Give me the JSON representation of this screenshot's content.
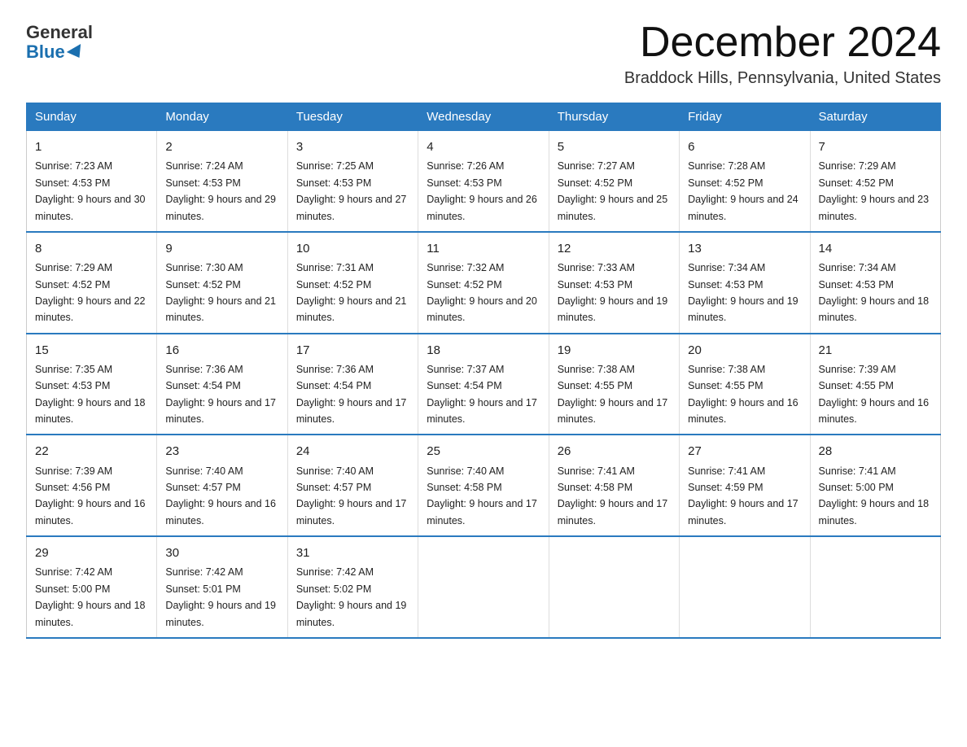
{
  "logo": {
    "line1": "General",
    "line2": "Blue"
  },
  "header": {
    "month": "December 2024",
    "location": "Braddock Hills, Pennsylvania, United States"
  },
  "weekdays": [
    "Sunday",
    "Monday",
    "Tuesday",
    "Wednesday",
    "Thursday",
    "Friday",
    "Saturday"
  ],
  "weeks": [
    [
      {
        "day": "1",
        "sunrise": "7:23 AM",
        "sunset": "4:53 PM",
        "daylight": "9 hours and 30 minutes."
      },
      {
        "day": "2",
        "sunrise": "7:24 AM",
        "sunset": "4:53 PM",
        "daylight": "9 hours and 29 minutes."
      },
      {
        "day": "3",
        "sunrise": "7:25 AM",
        "sunset": "4:53 PM",
        "daylight": "9 hours and 27 minutes."
      },
      {
        "day": "4",
        "sunrise": "7:26 AM",
        "sunset": "4:53 PM",
        "daylight": "9 hours and 26 minutes."
      },
      {
        "day": "5",
        "sunrise": "7:27 AM",
        "sunset": "4:52 PM",
        "daylight": "9 hours and 25 minutes."
      },
      {
        "day": "6",
        "sunrise": "7:28 AM",
        "sunset": "4:52 PM",
        "daylight": "9 hours and 24 minutes."
      },
      {
        "day": "7",
        "sunrise": "7:29 AM",
        "sunset": "4:52 PM",
        "daylight": "9 hours and 23 minutes."
      }
    ],
    [
      {
        "day": "8",
        "sunrise": "7:29 AM",
        "sunset": "4:52 PM",
        "daylight": "9 hours and 22 minutes."
      },
      {
        "day": "9",
        "sunrise": "7:30 AM",
        "sunset": "4:52 PM",
        "daylight": "9 hours and 21 minutes."
      },
      {
        "day": "10",
        "sunrise": "7:31 AM",
        "sunset": "4:52 PM",
        "daylight": "9 hours and 21 minutes."
      },
      {
        "day": "11",
        "sunrise": "7:32 AM",
        "sunset": "4:52 PM",
        "daylight": "9 hours and 20 minutes."
      },
      {
        "day": "12",
        "sunrise": "7:33 AM",
        "sunset": "4:53 PM",
        "daylight": "9 hours and 19 minutes."
      },
      {
        "day": "13",
        "sunrise": "7:34 AM",
        "sunset": "4:53 PM",
        "daylight": "9 hours and 19 minutes."
      },
      {
        "day": "14",
        "sunrise": "7:34 AM",
        "sunset": "4:53 PM",
        "daylight": "9 hours and 18 minutes."
      }
    ],
    [
      {
        "day": "15",
        "sunrise": "7:35 AM",
        "sunset": "4:53 PM",
        "daylight": "9 hours and 18 minutes."
      },
      {
        "day": "16",
        "sunrise": "7:36 AM",
        "sunset": "4:54 PM",
        "daylight": "9 hours and 17 minutes."
      },
      {
        "day": "17",
        "sunrise": "7:36 AM",
        "sunset": "4:54 PM",
        "daylight": "9 hours and 17 minutes."
      },
      {
        "day": "18",
        "sunrise": "7:37 AM",
        "sunset": "4:54 PM",
        "daylight": "9 hours and 17 minutes."
      },
      {
        "day": "19",
        "sunrise": "7:38 AM",
        "sunset": "4:55 PM",
        "daylight": "9 hours and 17 minutes."
      },
      {
        "day": "20",
        "sunrise": "7:38 AM",
        "sunset": "4:55 PM",
        "daylight": "9 hours and 16 minutes."
      },
      {
        "day": "21",
        "sunrise": "7:39 AM",
        "sunset": "4:55 PM",
        "daylight": "9 hours and 16 minutes."
      }
    ],
    [
      {
        "day": "22",
        "sunrise": "7:39 AM",
        "sunset": "4:56 PM",
        "daylight": "9 hours and 16 minutes."
      },
      {
        "day": "23",
        "sunrise": "7:40 AM",
        "sunset": "4:57 PM",
        "daylight": "9 hours and 16 minutes."
      },
      {
        "day": "24",
        "sunrise": "7:40 AM",
        "sunset": "4:57 PM",
        "daylight": "9 hours and 17 minutes."
      },
      {
        "day": "25",
        "sunrise": "7:40 AM",
        "sunset": "4:58 PM",
        "daylight": "9 hours and 17 minutes."
      },
      {
        "day": "26",
        "sunrise": "7:41 AM",
        "sunset": "4:58 PM",
        "daylight": "9 hours and 17 minutes."
      },
      {
        "day": "27",
        "sunrise": "7:41 AM",
        "sunset": "4:59 PM",
        "daylight": "9 hours and 17 minutes."
      },
      {
        "day": "28",
        "sunrise": "7:41 AM",
        "sunset": "5:00 PM",
        "daylight": "9 hours and 18 minutes."
      }
    ],
    [
      {
        "day": "29",
        "sunrise": "7:42 AM",
        "sunset": "5:00 PM",
        "daylight": "9 hours and 18 minutes."
      },
      {
        "day": "30",
        "sunrise": "7:42 AM",
        "sunset": "5:01 PM",
        "daylight": "9 hours and 19 minutes."
      },
      {
        "day": "31",
        "sunrise": "7:42 AM",
        "sunset": "5:02 PM",
        "daylight": "9 hours and 19 minutes."
      },
      null,
      null,
      null,
      null
    ]
  ]
}
